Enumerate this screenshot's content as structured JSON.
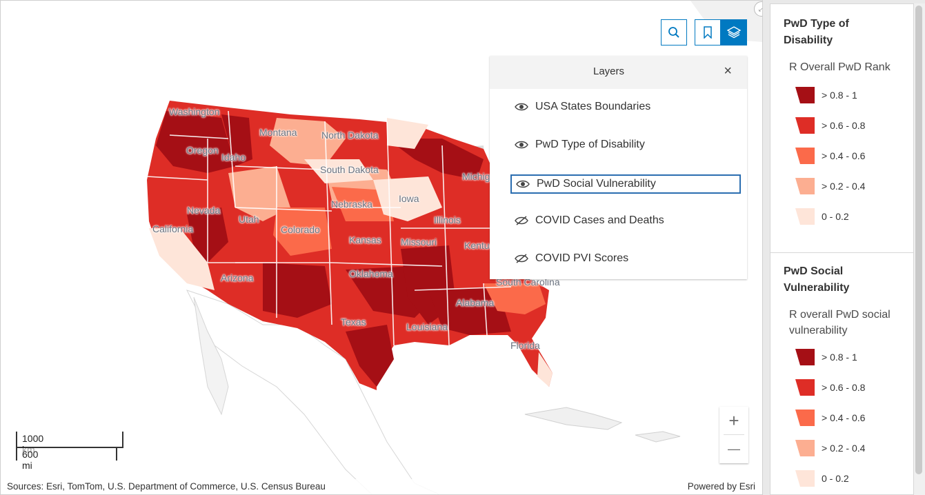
{
  "map": {
    "state_labels": [
      "Washington",
      "Montana",
      "North Dakota",
      "Oregon",
      "Idaho",
      "South Dakota",
      "Michigan",
      "Nevada",
      "Nebraska",
      "Iowa",
      "Utah",
      "Colorado",
      "California",
      "Illinois",
      "Kansas",
      "Missouri",
      "Kentucky",
      "Oklahoma",
      "Arizona",
      "South Carolina",
      "Alabama",
      "Texas",
      "Louisiana",
      "Florida"
    ],
    "attribution": "Sources: Esri, TomTom, U.S. Department of Commerce, U.S. Census Bureau",
    "powered_by": "Powered by Esri",
    "scale_km": "1000 km",
    "scale_mi": "600 mi"
  },
  "toolbar": {
    "search_icon": "search-icon",
    "bookmark_icon": "bookmark-icon",
    "layers_icon": "layers-icon",
    "accent": "#0079c1"
  },
  "layers_panel": {
    "title": "Layers",
    "close": "×",
    "items": [
      {
        "label": "USA States Boundaries",
        "visible": true
      },
      {
        "label": "PwD Type of Disability",
        "visible": true
      },
      {
        "label": "PwD Social Vulnerability",
        "visible": true
      },
      {
        "label": "COVID Cases and Deaths",
        "visible": false
      },
      {
        "label": "COVID PVI Scores",
        "visible": false
      }
    ]
  },
  "zoom": {
    "in": "+",
    "out": "—"
  },
  "legend": {
    "sections": [
      {
        "title": "PwD Type of Disability",
        "field": "R Overall PwD Rank",
        "classes": [
          {
            "label": "> 0.8 - 1",
            "color": "#a50f15"
          },
          {
            "label": "> 0.6 - 0.8",
            "color": "#de2d26"
          },
          {
            "label": "> 0.4 - 0.6",
            "color": "#fb6a4a"
          },
          {
            "label": "> 0.2 - 0.4",
            "color": "#fcae91"
          },
          {
            "label": "0 - 0.2",
            "color": "#fee5d9"
          }
        ]
      },
      {
        "title": "PwD Social Vulnerability",
        "field": "R overall PwD social vulnerability",
        "classes": [
          {
            "label": "> 0.8 - 1",
            "color": "#a50f15"
          },
          {
            "label": "> 0.6 - 0.8",
            "color": "#de2d26"
          },
          {
            "label": "> 0.4 - 0.6",
            "color": "#fb6a4a"
          },
          {
            "label": "> 0.2 - 0.4",
            "color": "#fcae91"
          },
          {
            "label": "0 - 0.2",
            "color": "#fee5d9"
          }
        ]
      }
    ]
  }
}
